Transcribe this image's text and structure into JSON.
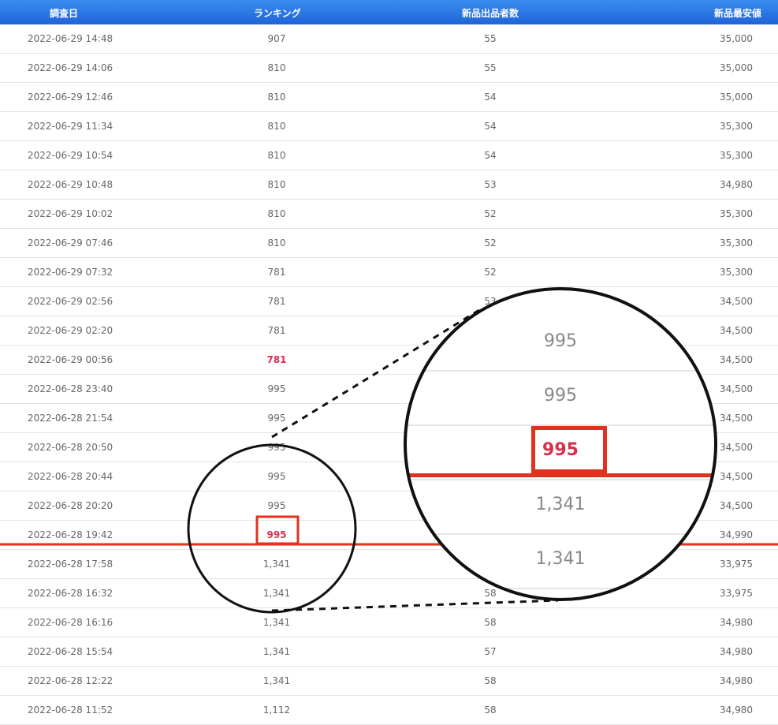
{
  "header": {
    "date": "調査日",
    "rank": "ランキング",
    "sellers": "新品出品者数",
    "price": "新品最安値"
  },
  "rows": [
    {
      "date": "2022-06-29 14:48",
      "rank": "907",
      "sellers": "55",
      "price": "35,000"
    },
    {
      "date": "2022-06-29 14:06",
      "rank": "810",
      "sellers": "55",
      "price": "35,000"
    },
    {
      "date": "2022-06-29 12:46",
      "rank": "810",
      "sellers": "54",
      "price": "35,000"
    },
    {
      "date": "2022-06-29 11:34",
      "rank": "810",
      "sellers": "54",
      "price": "35,300"
    },
    {
      "date": "2022-06-29 10:54",
      "rank": "810",
      "sellers": "54",
      "price": "35,300"
    },
    {
      "date": "2022-06-29 10:48",
      "rank": "810",
      "sellers": "53",
      "price": "34,980"
    },
    {
      "date": "2022-06-29 10:02",
      "rank": "810",
      "sellers": "52",
      "price": "35,300"
    },
    {
      "date": "2022-06-29 07:46",
      "rank": "810",
      "sellers": "52",
      "price": "35,300"
    },
    {
      "date": "2022-06-29 07:32",
      "rank": "781",
      "sellers": "52",
      "price": "35,300"
    },
    {
      "date": "2022-06-29 02:56",
      "rank": "781",
      "sellers": "53",
      "price": "34,500"
    },
    {
      "date": "2022-06-29 02:20",
      "rank": "781",
      "sellers": "",
      "price": "34,500"
    },
    {
      "date": "2022-06-29 00:56",
      "rank": "781",
      "sellers": "",
      "price": "34,500"
    },
    {
      "date": "2022-06-28 23:40",
      "rank": "995",
      "sellers": "",
      "price": "34,500"
    },
    {
      "date": "2022-06-28 21:54",
      "rank": "995",
      "sellers": "",
      "price": "34,500"
    },
    {
      "date": "2022-06-28 20:50",
      "rank": "995",
      "sellers": "",
      "price": "34,500"
    },
    {
      "date": "2022-06-28 20:44",
      "rank": "995",
      "sellers": "",
      "price": "34,500"
    },
    {
      "date": "2022-06-28 20:20",
      "rank": "995",
      "sellers": "",
      "price": "34,500"
    },
    {
      "date": "2022-06-28 19:42",
      "rank": "995",
      "sellers": "",
      "price": "34,990"
    },
    {
      "date": "2022-06-28 17:58",
      "rank": "1,341",
      "sellers": "",
      "price": "33,975"
    },
    {
      "date": "2022-06-28 16:32",
      "rank": "1,341",
      "sellers": "58",
      "price": "33,975"
    },
    {
      "date": "2022-06-28 16:16",
      "rank": "1,341",
      "sellers": "58",
      "price": "34,980"
    },
    {
      "date": "2022-06-28 15:54",
      "rank": "1,341",
      "sellers": "57",
      "price": "34,980"
    },
    {
      "date": "2022-06-28 12:22",
      "rank": "1,341",
      "sellers": "58",
      "price": "34,980"
    },
    {
      "date": "2022-06-28 11:52",
      "rank": "1,112",
      "sellers": "58",
      "price": "34,980"
    }
  ],
  "highlight_rows": [
    11,
    17
  ],
  "magnifier": {
    "rows": [
      "995",
      "995",
      "995",
      "1,341",
      "1,341"
    ],
    "highlight_index": 2
  },
  "colors": {
    "header": "#1f63d8",
    "marker": "#e0321c",
    "highlight_text": "#d6304d"
  }
}
